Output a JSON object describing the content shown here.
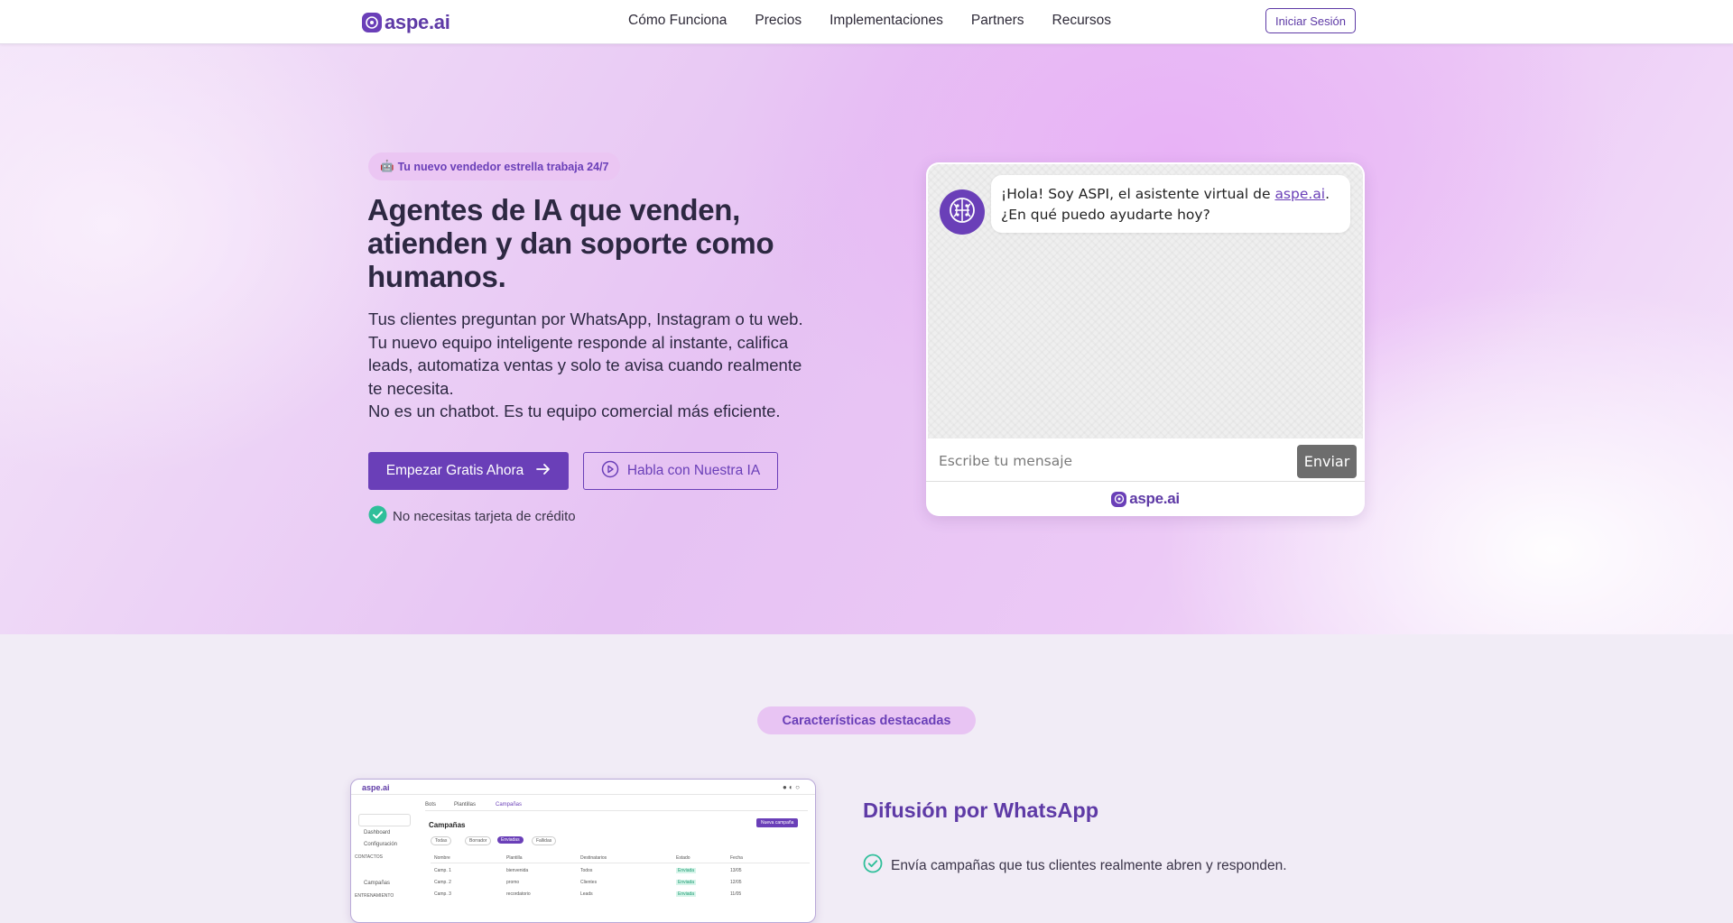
{
  "colors": {
    "brand": "#6a3fb8",
    "brand_light": "#e8c4f3",
    "check": "#2fbf9a"
  },
  "nav": {
    "logo_text": "aspe.ai",
    "links": [
      "Cómo Funciona",
      "Precios",
      "Implementaciones",
      "Partners",
      "Recursos"
    ],
    "login_label": "Iniciar Sesión"
  },
  "hero": {
    "badge_icon": "robot-emoji",
    "badge_emoji": "🤖",
    "badge_text": "Tu nuevo vendedor estrella trabaja 24/7",
    "title": "Agentes de IA que venden, atienden y dan soporte como humanos.",
    "subtitle_line1": "Tus clientes preguntan por WhatsApp, Instagram o tu web. Tu nuevo equipo inteligente responde al instante, califica leads, automatiza ventas y solo te avisa cuando realmente te necesita.",
    "subtitle_line2": "No es un chatbot. Es tu equipo comercial más eficiente.",
    "cta_primary": "Empezar Gratis Ahora",
    "cta_secondary": "Habla con Nuestra IA",
    "no_card": "No necesitas tarjeta de crédito"
  },
  "chat": {
    "message_pre": "¡Hola! Soy ASPI, el asistente virtual de ",
    "message_link": "aspe.ai",
    "message_post": ". ¿En qué puedo ayudarte hoy?",
    "input_placeholder": "Escribe tu mensaje",
    "send_label": "Enviar",
    "footer_logo": "aspe.ai"
  },
  "features": {
    "pill": "Características destacadas",
    "title": "Difusión por WhatsApp",
    "items": [
      "Envía campañas que tus clientes realmente abren y responden."
    ],
    "mockup": {
      "logo": "aspe.ai",
      "tabs": [
        "Bots",
        "Plantillas",
        "Campañas"
      ],
      "page_title": "Campañas",
      "filters": [
        "Todas",
        "Borrador",
        "Enviadas",
        "Fallidas"
      ],
      "side_items": [
        "Dashboard",
        "Configuración",
        "Campañas"
      ],
      "side_sections": [
        "CONTACTOS",
        "ENTRENAMIENTO"
      ],
      "columns": [
        "Nombre",
        "Plantilla",
        "Destinatarios",
        "Estado",
        "Fecha"
      ],
      "rows": [
        [
          "Camp. 1",
          "bienvenida",
          "Todos",
          "Enviada",
          "13/05"
        ],
        [
          "Camp. 2",
          "promo",
          "Clientes",
          "Enviada",
          "12/05"
        ],
        [
          "Camp. 3",
          "recordatorio",
          "Leads",
          "Enviada",
          "11/05"
        ]
      ],
      "new_button": "Nueva campaña"
    }
  }
}
